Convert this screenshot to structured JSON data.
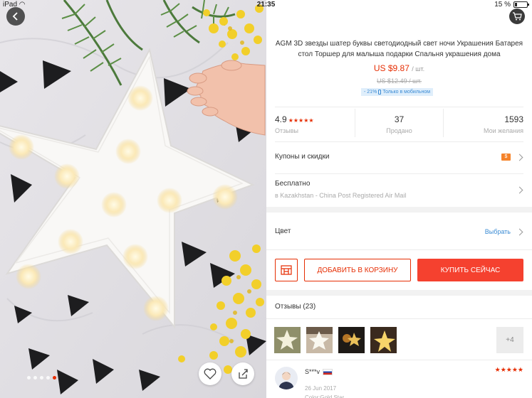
{
  "status": {
    "device": "iPad",
    "time": "21:35",
    "battery": "15 %"
  },
  "gallery": {
    "image_count": 5,
    "active_index": 4
  },
  "product": {
    "title": "AGM 3D звезды шатер буквы светодиодный свет ночи Украшения Батарея стол Торшер для малыша подарки Спальня украшения дома",
    "price": "US $9.87",
    "price_unit": "/ шт.",
    "old_price": "US $12.49",
    "old_price_unit": "/ шт.",
    "mobile_discount": "- 21%",
    "mobile_label": "Только в мобильном"
  },
  "stats": {
    "rating": "4.9",
    "rating_stars": 5,
    "rating_label": "Отзывы",
    "sold": "37",
    "sold_label": "Продано",
    "wishlist": "1593",
    "wishlist_label": "Мои желания"
  },
  "coupons": {
    "label": "Купоны и скидки",
    "badge": "$"
  },
  "shipping": {
    "label": "Бесплатно",
    "detail": "в Kazakhstan - China Post Registered Air Mail"
  },
  "color": {
    "label": "Цвет",
    "action": "Выбрать"
  },
  "actions": {
    "add_to_cart": "ДОБАВИТЬ В КОРЗИНУ",
    "buy_now": "КУПИТЬ СЕЙЧАС"
  },
  "reviews": {
    "title": "Отзывы (23)",
    "more": "+4",
    "first": {
      "name": "S***v",
      "stars": 5,
      "date": "26 Jun 2017",
      "color": "Color:Gold Star"
    }
  },
  "colors": {
    "accent": "#e62e04",
    "buy": "#f5412f",
    "coupon": "#f5832a",
    "mobile_bg": "#dfeefb",
    "mobile_text": "#3a8bd4"
  }
}
